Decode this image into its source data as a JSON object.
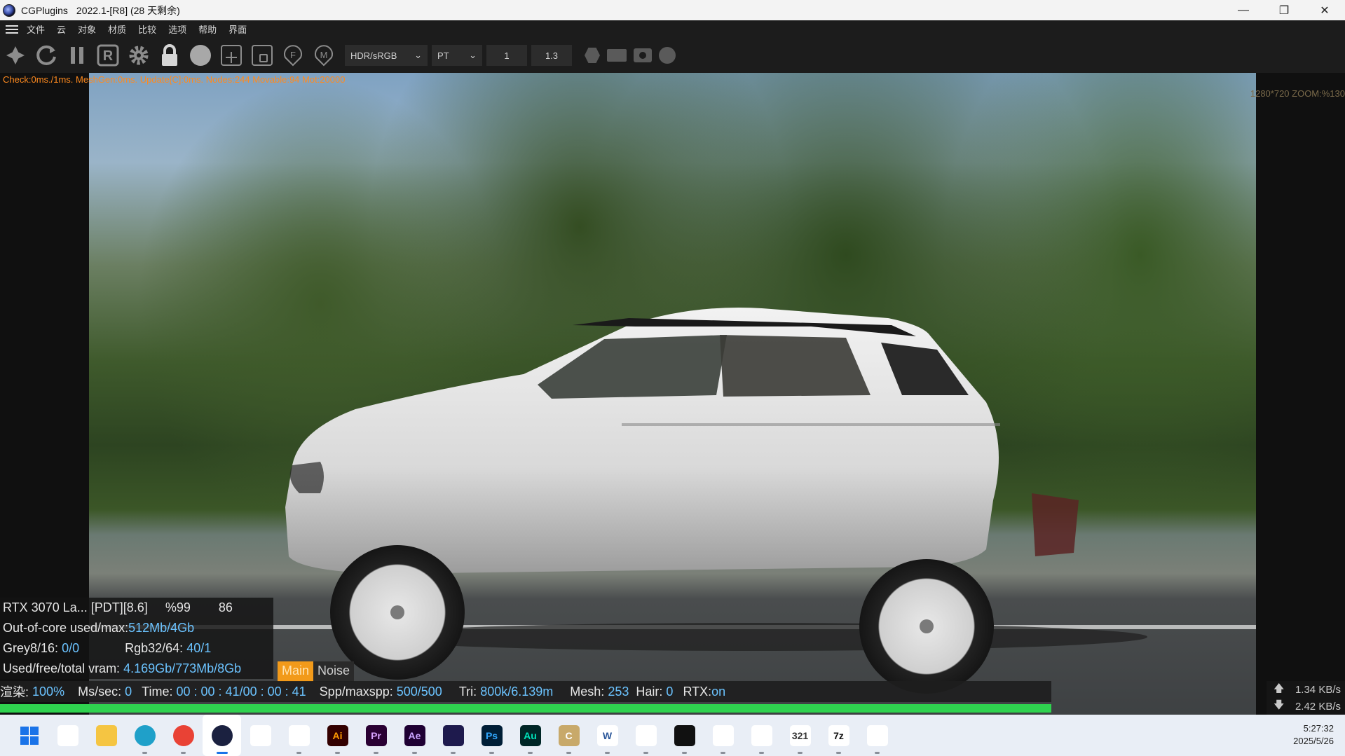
{
  "window": {
    "app_name": "CGPlugins",
    "version": "2022.1-[R8] (28 天剩余)",
    "controls": [
      "minimize-icon",
      "restore-icon",
      "close-icon"
    ]
  },
  "menu": [
    "文件",
    "云",
    "对象",
    "材质",
    "比较",
    "选项",
    "帮助",
    "界面"
  ],
  "toolbar": {
    "icons": [
      "aperture-icon",
      "refresh-icon",
      "pause-icon",
      "r-icon",
      "gear-icon",
      "lock-icon",
      "sphere-icon",
      "add-box-icon",
      "crop-icon",
      "f-badge-icon",
      "m-badge-icon"
    ],
    "color_mode": "HDR/sRGB",
    "render_mode": "PT",
    "value1": "1",
    "value2": "1.3",
    "shape_icons": [
      "hexagon-icon",
      "rectangle-icon",
      "camera-icon",
      "circle-icon"
    ]
  },
  "viewport": {
    "stats_top": "Check:0ms./1ms. MeshGen:0ms. Update[C]:0ms. Nodes:244 Movable:94 Mot:20000",
    "zoom_info": "1280*720 ZOOM:%130"
  },
  "info": {
    "gpu": "RTX 3070 La...",
    "pdt": "[PDT][8.6]",
    "gpu_load": "%99",
    "temp": "86",
    "ooc_label": "Out-of-core used/max:",
    "ooc_value": "512Mb/4Gb",
    "grey_label": "Grey8/16:",
    "grey_value": "0/0",
    "rgb_label": "Rgb32/64:",
    "rgb_value": "40/1",
    "vram_label": "Used/free/total vram:",
    "vram_value": "4.169Gb/773Mb/8Gb",
    "tab_main": "Main",
    "tab_noise": "Noise"
  },
  "status": {
    "render_label": "渲染:",
    "render_value": "100%",
    "ms_label": "Ms/sec:",
    "ms_value": "0",
    "time_label": "Time:",
    "time_value": "00 : 00 : 41/00 : 00 : 41",
    "spp_label": "Spp/maxspp:",
    "spp_value": "500/500",
    "tri_label": "Tri:",
    "tri_value": "800k/6.139m",
    "mesh_label": "Mesh:",
    "mesh_value": "253",
    "hair_label": "Hair:",
    "hair_value": "0",
    "rtx_label": "RTX:",
    "rtx_value": "on",
    "progress": 1.0,
    "progress_color": "#2fd34f"
  },
  "net": {
    "up": "1.34 KB/s",
    "down": "2.42 KB/s"
  },
  "taskbar": {
    "apps": [
      {
        "name": "start-icon",
        "label": "",
        "bg": "#ffffff",
        "fg": "#1a73e8"
      },
      {
        "name": "task-view-icon",
        "label": "",
        "bg": "#ffffff",
        "fg": "#333333"
      },
      {
        "name": "file-explorer-icon",
        "label": "",
        "bg": "#f5c542",
        "fg": "#333333"
      },
      {
        "name": "edge-icon",
        "label": "",
        "bg": "#1fa0c9",
        "fg": "#ffffff"
      },
      {
        "name": "chrome-icon",
        "label": "",
        "bg": "#e94235",
        "fg": "#ffffff"
      },
      {
        "name": "cinema4d-icon",
        "label": "",
        "bg": "#1b2140",
        "fg": "#ffffff"
      },
      {
        "name": "alien-icon",
        "label": "",
        "bg": "#ffffff",
        "fg": "#111111"
      },
      {
        "name": "twitch-icon",
        "label": "",
        "bg": "#ffffff",
        "fg": "#222222"
      },
      {
        "name": "illustrator-icon",
        "label": "Ai",
        "bg": "#330000",
        "fg": "#ff9a00"
      },
      {
        "name": "premiere-icon",
        "label": "Pr",
        "bg": "#2a0033",
        "fg": "#d9a3ff"
      },
      {
        "name": "after-effects-icon",
        "label": "Ae",
        "bg": "#1f0033",
        "fg": "#c9a3ff"
      },
      {
        "name": "vs-icon",
        "label": "",
        "bg": "#1e1a4d",
        "fg": "#a08cff"
      },
      {
        "name": "photoshop-icon",
        "label": "Ps",
        "bg": "#001e36",
        "fg": "#31a8ff"
      },
      {
        "name": "audition-icon",
        "label": "Au",
        "bg": "#002626",
        "fg": "#00e4bb"
      },
      {
        "name": "c-app-icon",
        "label": "C",
        "bg": "#c8a96a",
        "fg": "#ffffff"
      },
      {
        "name": "word-icon",
        "label": "W",
        "bg": "#ffffff",
        "fg": "#2b579a"
      },
      {
        "name": "search-tool-icon",
        "label": "",
        "bg": "#ffffff",
        "fg": "#e88a1a"
      },
      {
        "name": "terminal-icon",
        "label": "",
        "bg": "#111111",
        "fg": "#ffffff"
      },
      {
        "name": "book-icon",
        "label": "",
        "bg": "#ffffff",
        "fg": "#333333"
      },
      {
        "name": "remote-icon",
        "label": "",
        "bg": "#ffffff",
        "fg": "#2ab34f"
      },
      {
        "name": "calendar-icon",
        "label": "321",
        "bg": "#ffffff",
        "fg": "#333333"
      },
      {
        "name": "7zip-icon",
        "label": "7z",
        "bg": "#ffffff",
        "fg": "#111111"
      },
      {
        "name": "baidu-cloud-icon",
        "label": "",
        "bg": "#ffffff",
        "fg": "#2b7bf0"
      }
    ],
    "time": "5:27:32",
    "date": "2025/5/26"
  }
}
